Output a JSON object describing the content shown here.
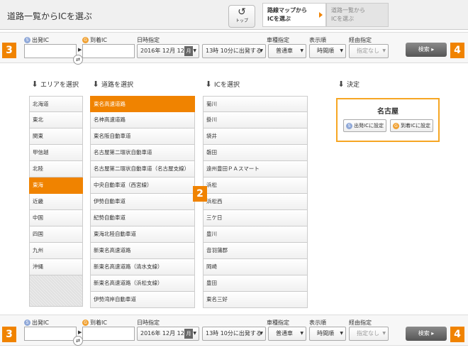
{
  "header": {
    "title": "道路一覧からICを選ぶ",
    "top_button_label": "トップ",
    "step_active": [
      "路線マップから",
      "ICを選ぶ"
    ],
    "step_inactive": [
      "道路一覧から",
      "ICを選ぶ"
    ]
  },
  "search": {
    "start_label": "出発IC",
    "goal_label": "到着IC",
    "start_icon": "S",
    "goal_icon": "G",
    "datetime_label": "日時指定",
    "date_value": "2016年 12月 12日",
    "calendar_label": "月",
    "time_value": "13時 10分に出発する",
    "vehicle_label": "車種指定",
    "vehicle_value": "普通車",
    "order_label": "表示順",
    "order_value": "時間順",
    "via_label": "経由指定",
    "via_value": "指定なし",
    "search_button": "検索"
  },
  "badges": {
    "input": "3",
    "search": "4",
    "list": "2"
  },
  "columns": {
    "area": "エリアを選択",
    "road": "道路を選択",
    "ic": "ICを選択",
    "decide": "決定"
  },
  "areas": [
    "北海道",
    "東北",
    "関東",
    "甲信越",
    "北陸",
    "東海",
    "近畿",
    "中国",
    "四国",
    "九州",
    "沖縄"
  ],
  "selected_area": 5,
  "roads": [
    "東名高速道路",
    "名神高速道路",
    "東名阪自動車道",
    "名古屋第二環状自動車道",
    "名古屋第二環状自動車道（名古屋支線）",
    "中央自動車道（西宮線）",
    "伊勢自動車道",
    "紀勢自動車道",
    "東海北陸自動車道",
    "新東名高速道路",
    "新東名高速道路（清水支線）",
    "新東名高速道路（浜松支線）",
    "伊勢湾岸自動車道"
  ],
  "selected_road": 0,
  "ics": [
    "菊川",
    "掛川",
    "袋井",
    "磐田",
    "遠州豊田ＰＡスマート",
    "浜松",
    "浜松西",
    "三ケ日",
    "豊川",
    "音羽蒲郡",
    "岡崎",
    "豊田",
    "東名三好"
  ],
  "decision": {
    "ic_name": "名古屋",
    "set_start_button": "出発ICに設定",
    "set_goal_button": "到着ICに設定"
  }
}
